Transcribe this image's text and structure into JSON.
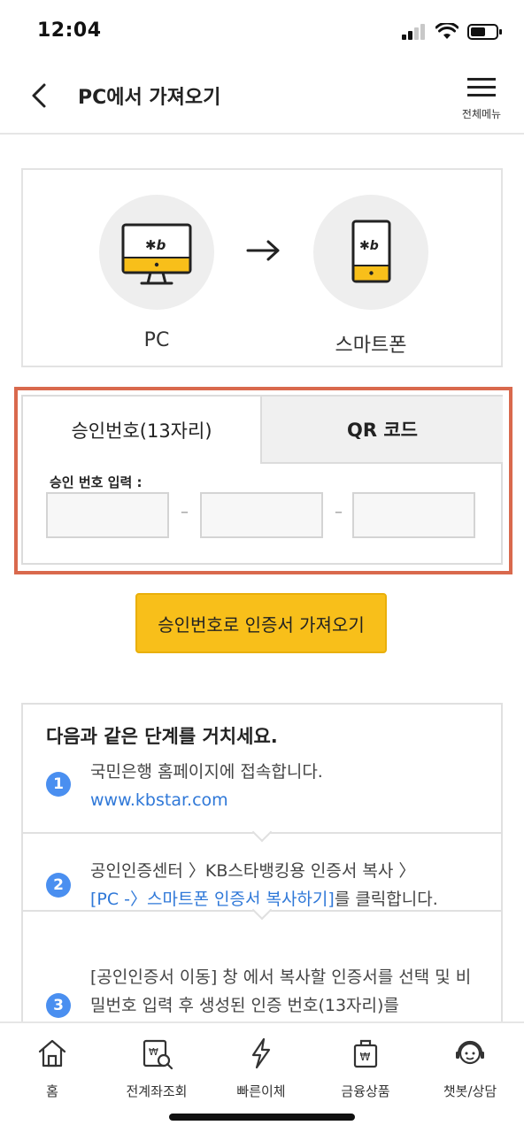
{
  "status_bar": {
    "time": "12:04"
  },
  "header": {
    "title": "PC에서 가져오기",
    "menu_label": "전체메뉴"
  },
  "transfer": {
    "from_label": "PC",
    "to_label": "스마트폰",
    "logo_text": "KB"
  },
  "auth": {
    "tabs": [
      {
        "label": "승인번호(13자리)",
        "active": true
      },
      {
        "label": "QR 코드",
        "active": false
      }
    ],
    "input_label": "승인 번호 입력 :",
    "inputs": [
      "",
      "",
      ""
    ],
    "separator": "–"
  },
  "primary_button": {
    "label": "승인번호로 인증서 가져오기"
  },
  "steps": {
    "heading": "다음과 같은 단계를 거치세요.",
    "items": [
      {
        "num": "1",
        "text": "국민은행 홈페이지에 접속합니다.",
        "link": "www.kbstar.com",
        "after": ""
      },
      {
        "num": "2",
        "text": "공인인증센터 〉KB스타뱅킹용 인증서 복사 〉",
        "link": "[PC -〉스마트폰 인증서 복사하기]",
        "after": "를 클릭합니다."
      },
      {
        "num": "3",
        "text": "[공인인증서 이동] 창 에서 복사할 인증서를 선택 및 비밀번호 입력 후 생성된 인증 번호(13자리)를",
        "link": "",
        "after": ""
      }
    ]
  },
  "bottom_nav": [
    {
      "label": "홈",
      "icon": "home-icon"
    },
    {
      "label": "전계좌조회",
      "icon": "account-search-icon"
    },
    {
      "label": "빠른이체",
      "icon": "lightning-icon"
    },
    {
      "label": "금융상품",
      "icon": "shopping-bag-icon"
    },
    {
      "label": "챗봇/상담",
      "icon": "chatbot-icon"
    }
  ],
  "colors": {
    "accent": "#f8bf1a",
    "link": "#2f78d8",
    "step_badge": "#4a8ff0",
    "highlight": "#d9694d"
  }
}
